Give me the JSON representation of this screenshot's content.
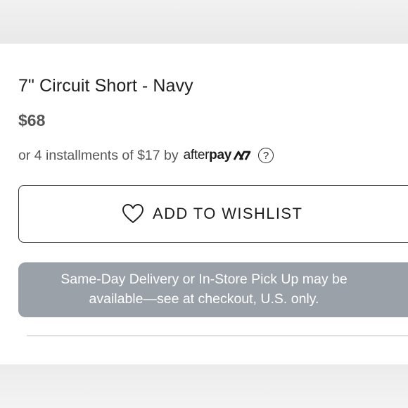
{
  "product": {
    "title": "7\" Circuit Short - Navy",
    "price": "$68"
  },
  "installments": {
    "text": "or 4 installments of $17 by",
    "logo_after": "after",
    "logo_pay": "pay",
    "help_icon": "question-circle-icon",
    "help_glyph": "?"
  },
  "wishlist": {
    "icon": "heart-outline-icon",
    "label": "ADD TO WISHLIST"
  },
  "delivery": {
    "line1": "Same-Day Delivery or In-Store Pick Up may be",
    "line2": "available—see at checkout, U.S. only."
  },
  "colors": {
    "banner": "#9aa1a9",
    "price": "#555555",
    "text": "#1f1f1f"
  }
}
